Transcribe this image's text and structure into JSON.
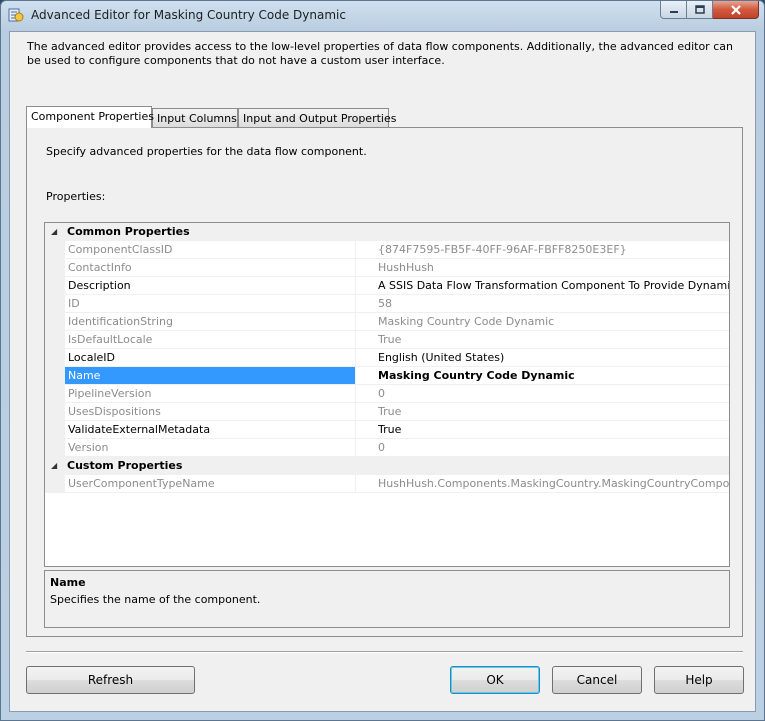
{
  "window": {
    "title": "Advanced Editor for Masking Country Code Dynamic"
  },
  "intro_text": "The advanced editor provides access to the low-level properties of data flow components. Additionally, the advanced editor can be used to configure components that do not have a custom user interface.",
  "tabs": [
    {
      "label": "Component Properties",
      "active": true
    },
    {
      "label": "Input Columns",
      "active": false
    },
    {
      "label": "Input and Output Properties",
      "active": false
    }
  ],
  "panel": {
    "description": "Specify advanced properties for the data flow component.",
    "properties_label": "Properties:"
  },
  "grid": {
    "categories": [
      {
        "name": "Common Properties",
        "expanded": true,
        "rows": [
          {
            "name": "ComponentClassID",
            "value": "{874F7595-FB5F-40FF-96AF-FBFF8250E3EF}",
            "read_only": true
          },
          {
            "name": "ContactInfo",
            "value": "HushHush",
            "read_only": true
          },
          {
            "name": "Description",
            "value": "A SSIS Data Flow Transformation Component To Provide Dynamic Co",
            "read_only": false
          },
          {
            "name": "ID",
            "value": "58",
            "read_only": true
          },
          {
            "name": "IdentificationString",
            "value": "Masking Country Code Dynamic",
            "read_only": true
          },
          {
            "name": "IsDefaultLocale",
            "value": "True",
            "read_only": true
          },
          {
            "name": "LocaleID",
            "value": "English (United States)",
            "read_only": false
          },
          {
            "name": "Name",
            "value": "Masking Country Code Dynamic",
            "read_only": false,
            "selected": true
          },
          {
            "name": "PipelineVersion",
            "value": "0",
            "read_only": true
          },
          {
            "name": "UsesDispositions",
            "value": "True",
            "read_only": true
          },
          {
            "name": "ValidateExternalMetadata",
            "value": "True",
            "read_only": false
          },
          {
            "name": "Version",
            "value": "0",
            "read_only": true
          }
        ]
      },
      {
        "name": "Custom Properties",
        "expanded": true,
        "rows": [
          {
            "name": "UserComponentTypeName",
            "value": "HushHush.Components.MaskingCountry.MaskingCountryComponen",
            "read_only": true
          }
        ]
      }
    ]
  },
  "help": {
    "title": "Name",
    "text": "Specifies the name of the component."
  },
  "buttons": {
    "refresh": "Refresh",
    "ok": "OK",
    "cancel": "Cancel",
    "help": "Help"
  },
  "colors": {
    "selection": "#3399ff",
    "read_only_text": "#8c8c8c",
    "close_button": "#c9452c"
  }
}
